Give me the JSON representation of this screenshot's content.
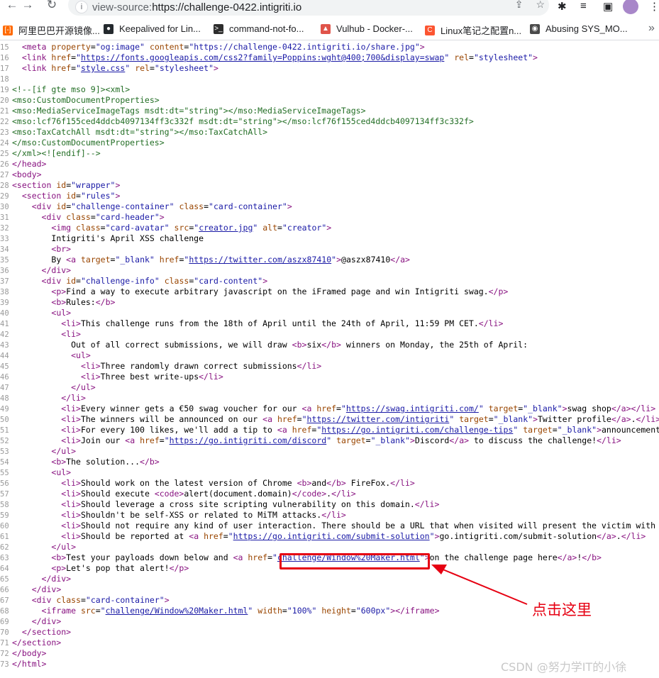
{
  "browser": {
    "url_scheme": "view-source:",
    "url_rest": "https://challenge-0422.intigriti.io"
  },
  "bookmarks": [
    {
      "label": "阿里巴巴开源镜像...",
      "icon": "aliyun-icon",
      "color": "#ff6a00"
    },
    {
      "label": "Keepalived for Lin...",
      "icon": "github-icon",
      "color": "#24292e"
    },
    {
      "label": "command-not-fo...",
      "icon": "terminal-icon",
      "color": "#2d2d2d"
    },
    {
      "label": "Vulhub - Docker-...",
      "icon": "vulhub-icon",
      "color": "#e0544a"
    },
    {
      "label": "Linux笔记之配置n...",
      "icon": "csdn-icon",
      "color": "#fc5531"
    },
    {
      "label": "Abusing SYS_MO...",
      "icon": "globe-icon",
      "color": "#4a4a4a"
    }
  ],
  "source_lines": [
    {
      "n": "15",
      "html": "  <span class='tag'>&lt;meta</span> <span class='attr'>property</span>=<span class='val'>\"og:image\"</span> <span class='attr'>content</span>=<span class='val'>\"https://challenge-0422.intigriti.io/share.jpg\"</span><span class='tag'>&gt;</span>"
    },
    {
      "n": "16",
      "html": "  <span class='tag'>&lt;link</span> <span class='attr'>href</span>=<span class='val'>\"</span><span class='link'>https://fonts.googleapis.com/css2?family=Poppins:wght@400;700&amp;display=swap</span><span class='val'>\"</span> <span class='attr'>rel</span>=<span class='val'>\"stylesheet\"</span><span class='tag'>&gt;</span>"
    },
    {
      "n": "17",
      "html": "  <span class='tag'>&lt;link</span> <span class='attr'>href</span>=<span class='val'>\"</span><span class='link'>style.css</span><span class='val'>\"</span> <span class='attr'>rel</span>=<span class='val'>\"stylesheet\"</span><span class='tag'>&gt;</span>"
    },
    {
      "n": "18",
      "html": ""
    },
    {
      "n": "19",
      "html": "<span class='comment'>&lt;!--[if gte mso 9]&gt;&lt;xml&gt;</span>"
    },
    {
      "n": "20",
      "html": "<span class='comment'>&lt;mso:CustomDocumentProperties&gt;</span>"
    },
    {
      "n": "21",
      "html": "<span class='comment'>&lt;mso:MediaServiceImageTags msdt:dt=\"string\"&gt;&lt;/mso:MediaServiceImageTags&gt;</span>"
    },
    {
      "n": "22",
      "html": "<span class='comment'>&lt;mso:lcf76f155ced4ddcb4097134ff3c332f msdt:dt=\"string\"&gt;&lt;/mso:lcf76f155ced4ddcb4097134ff3c332f&gt;</span>"
    },
    {
      "n": "23",
      "html": "<span class='comment'>&lt;mso:TaxCatchAll msdt:dt=\"string\"&gt;&lt;/mso:TaxCatchAll&gt;</span>"
    },
    {
      "n": "24",
      "html": "<span class='comment'>&lt;/mso:CustomDocumentProperties&gt;</span>"
    },
    {
      "n": "25",
      "html": "<span class='comment'>&lt;/xml&gt;&lt;![endif]--&gt;</span>"
    },
    {
      "n": "26",
      "html": "<span class='tag'>&lt;/head&gt;</span>"
    },
    {
      "n": "27",
      "html": "<span class='tag'>&lt;body&gt;</span>"
    },
    {
      "n": "28",
      "html": "<span class='tag'>&lt;section</span> <span class='attr'>id</span>=<span class='val'>\"wrapper\"</span><span class='tag'>&gt;</span>"
    },
    {
      "n": "29",
      "html": "  <span class='tag'>&lt;section</span> <span class='attr'>id</span>=<span class='val'>\"rules\"</span><span class='tag'>&gt;</span>"
    },
    {
      "n": "30",
      "html": "    <span class='tag'>&lt;div</span> <span class='attr'>id</span>=<span class='val'>\"challenge-container\"</span> <span class='attr'>class</span>=<span class='val'>\"card-container\"</span><span class='tag'>&gt;</span>"
    },
    {
      "n": "31",
      "html": "      <span class='tag'>&lt;div</span> <span class='attr'>class</span>=<span class='val'>\"card-header\"</span><span class='tag'>&gt;</span>"
    },
    {
      "n": "32",
      "html": "        <span class='tag'>&lt;img</span> <span class='attr'>class</span>=<span class='val'>\"card-avatar\"</span> <span class='attr'>src</span>=<span class='val'>\"</span><span class='link'>creator.jpg</span><span class='val'>\"</span> <span class='attr'>alt</span>=<span class='val'>\"creator\"</span><span class='tag'>&gt;</span>"
    },
    {
      "n": "33",
      "html": "        <span class='txt'>Intigriti's April XSS challenge</span>"
    },
    {
      "n": "34",
      "html": "        <span class='tag'>&lt;br&gt;</span>"
    },
    {
      "n": "35",
      "html": "        <span class='txt'>By </span><span class='tag'>&lt;a</span> <span class='attr'>target</span>=<span class='val'>\"_blank\"</span> <span class='attr'>href</span>=<span class='val'>\"</span><span class='link'>https://twitter.com/aszx87410</span><span class='val'>\"</span><span class='tag'>&gt;</span><span class='txt'>@aszx87410</span><span class='tag'>&lt;/a&gt;</span>"
    },
    {
      "n": "36",
      "html": "      <span class='tag'>&lt;/div&gt;</span>"
    },
    {
      "n": "37",
      "html": "      <span class='tag'>&lt;div</span> <span class='attr'>id</span>=<span class='val'>\"challenge-info\"</span> <span class='attr'>class</span>=<span class='val'>\"card-content\"</span><span class='tag'>&gt;</span>"
    },
    {
      "n": "38",
      "html": "        <span class='tag'>&lt;p&gt;</span><span class='txt'>Find a way to execute arbitrary javascript on the iFramed page and win Intigriti swag.</span><span class='tag'>&lt;/p&gt;</span>"
    },
    {
      "n": "39",
      "html": "        <span class='tag'>&lt;b&gt;</span><span class='txt'>Rules:</span><span class='tag'>&lt;/b&gt;</span>"
    },
    {
      "n": "40",
      "html": "        <span class='tag'>&lt;ul&gt;</span>"
    },
    {
      "n": "41",
      "html": "          <span class='tag'>&lt;li&gt;</span><span class='txt'>This challenge runs from the 18th of April until the 24th of April, 11:59 PM CET.</span><span class='tag'>&lt;/li&gt;</span>"
    },
    {
      "n": "42",
      "html": "          <span class='tag'>&lt;li&gt;</span>"
    },
    {
      "n": "43",
      "html": "            <span class='txt'>Out of all correct submissions, we will draw </span><span class='tag'>&lt;b&gt;</span><span class='txt'>six</span><span class='tag'>&lt;/b&gt;</span><span class='txt'> winners on Monday, the 25th of April:</span>"
    },
    {
      "n": "44",
      "html": "            <span class='tag'>&lt;ul&gt;</span>"
    },
    {
      "n": "45",
      "html": "              <span class='tag'>&lt;li&gt;</span><span class='txt'>Three randomly drawn correct submissions</span><span class='tag'>&lt;/li&gt;</span>"
    },
    {
      "n": "46",
      "html": "              <span class='tag'>&lt;li&gt;</span><span class='txt'>Three best write-ups</span><span class='tag'>&lt;/li&gt;</span>"
    },
    {
      "n": "47",
      "html": "            <span class='tag'>&lt;/ul&gt;</span>"
    },
    {
      "n": "48",
      "html": "          <span class='tag'>&lt;/li&gt;</span>"
    },
    {
      "n": "49",
      "html": "          <span class='tag'>&lt;li&gt;</span><span class='txt'>Every winner gets a €50 swag voucher for our </span><span class='tag'>&lt;a</span> <span class='attr'>href</span>=<span class='val'>\"</span><span class='link'>https://swag.intigriti.com/</span><span class='val'>\"</span> <span class='attr'>target</span>=<span class='val'>\"_blank\"</span><span class='tag'>&gt;</span><span class='txt'>swag shop</span><span class='tag'>&lt;/a&gt;&lt;/li&gt;</span>"
    },
    {
      "n": "50",
      "html": "          <span class='tag'>&lt;li&gt;</span><span class='txt'>The winners will be announced on our </span><span class='tag'>&lt;a</span> <span class='attr'>href</span>=<span class='val'>\"</span><span class='link'>https://twitter.com/intigriti</span><span class='val'>\"</span> <span class='attr'>target</span>=<span class='val'>\"_blank\"</span><span class='tag'>&gt;</span><span class='txt'>Twitter profile</span><span class='tag'>&lt;/a&gt;</span><span class='txt'>.</span><span class='tag'>&lt;/li&gt;</span>"
    },
    {
      "n": "51",
      "html": "          <span class='tag'>&lt;li&gt;</span><span class='txt'>For every 100 likes, we'll add a tip to </span><span class='tag'>&lt;a</span> <span class='attr'>href</span>=<span class='val'>\"</span><span class='link'>https://go.intigriti.com/challenge-tips</span><span class='val'>\"</span> <span class='attr'>target</span>=<span class='val'>\"_blank\"</span><span class='tag'>&gt;</span><span class='txt'>announcements</span><span class='tag'>&lt;/a&gt;</span>"
    },
    {
      "n": "52",
      "html": "          <span class='tag'>&lt;li&gt;</span><span class='txt'>Join our </span><span class='tag'>&lt;a</span> <span class='attr'>href</span>=<span class='val'>\"</span><span class='link'>https://go.intigriti.com/discord</span><span class='val'>\"</span> <span class='attr'>target</span>=<span class='val'>\"_blank\"</span><span class='tag'>&gt;</span><span class='txt'>Discord</span><span class='tag'>&lt;/a&gt;</span><span class='txt'> to discuss the challenge!</span><span class='tag'>&lt;/li&gt;</span>"
    },
    {
      "n": "53",
      "html": "        <span class='tag'>&lt;/ul&gt;</span>"
    },
    {
      "n": "54",
      "html": "        <span class='tag'>&lt;b&gt;</span><span class='txt'>The solution...</span><span class='tag'>&lt;/b&gt;</span>"
    },
    {
      "n": "55",
      "html": "        <span class='tag'>&lt;ul&gt;</span>"
    },
    {
      "n": "56",
      "html": "          <span class='tag'>&lt;li&gt;</span><span class='txt'>Should work on the latest version of Chrome </span><span class='tag'>&lt;b&gt;</span><span class='txt'>and</span><span class='tag'>&lt;/b&gt;</span><span class='txt'> FireFox.</span><span class='tag'>&lt;/li&gt;</span>"
    },
    {
      "n": "57",
      "html": "          <span class='tag'>&lt;li&gt;</span><span class='txt'>Should execute </span><span class='tag'>&lt;code&gt;</span><span class='txt'>alert(document.domain)</span><span class='tag'>&lt;/code&gt;</span><span class='txt'>.</span><span class='tag'>&lt;/li&gt;</span>"
    },
    {
      "n": "58",
      "html": "          <span class='tag'>&lt;li&gt;</span><span class='txt'>Should leverage a cross site scripting vulnerability on this domain.</span><span class='tag'>&lt;/li&gt;</span>"
    },
    {
      "n": "59",
      "html": "          <span class='tag'>&lt;li&gt;</span><span class='txt'>Shouldn't be self-XSS or related to MiTM attacks.</span><span class='tag'>&lt;/li&gt;</span>"
    },
    {
      "n": "60",
      "html": "          <span class='tag'>&lt;li&gt;</span><span class='txt'>Should not require any kind of user interaction. There should be a URL that when visited will present the victim with</span>"
    },
    {
      "n": "61",
      "html": "          <span class='tag'>&lt;li&gt;</span><span class='txt'>Should be reported at </span><span class='tag'>&lt;a</span> <span class='attr'>href</span>=<span class='val'>\"</span><span class='link'>https://go.intigriti.com/submit-solution</span><span class='val'>\"</span><span class='tag'>&gt;</span><span class='txt'>go.intigriti.com/submit-solution</span><span class='tag'>&lt;/a&gt;</span><span class='txt'>.</span><span class='tag'>&lt;/li&gt;</span>"
    },
    {
      "n": "62",
      "html": "        <span class='tag'>&lt;/ul&gt;</span>"
    },
    {
      "n": "63",
      "html": "        <span class='tag'>&lt;b&gt;</span><span class='txt'>Test your payloads down below and </span><span class='tag'>&lt;a</span> <span class='attr'>href</span>=<span class='val'>\"</span><span class='link'>challenge/Window%20Maker.html</span><span class='val'>\"</span><span class='tag'>&gt;</span><span class='txt'>on the challenge page here</span><span class='tag'>&lt;/a&gt;</span><span class='txt'>!</span><span class='tag'>&lt;/b&gt;</span>"
    },
    {
      "n": "64",
      "html": "        <span class='tag'>&lt;p&gt;</span><span class='txt'>Let's pop that alert!</span><span class='tag'>&lt;/p&gt;</span>"
    },
    {
      "n": "65",
      "html": "      <span class='tag'>&lt;/div&gt;</span>"
    },
    {
      "n": "66",
      "html": "    <span class='tag'>&lt;/div&gt;</span>"
    },
    {
      "n": "67",
      "html": "    <span class='tag'>&lt;div</span> <span class='attr'>class</span>=<span class='val'>\"card-container\"</span><span class='tag'>&gt;</span>"
    },
    {
      "n": "68",
      "html": "      <span class='tag'>&lt;iframe</span> <span class='attr'>src</span>=<span class='val'>\"</span><span class='link'>challenge/Window%20Maker.html</span><span class='val'>\"</span> <span class='attr'>width</span>=<span class='val'>\"100%\"</span> <span class='attr'>height</span>=<span class='val'>\"600px\"</span><span class='tag'>&gt;&lt;/iframe&gt;</span>"
    },
    {
      "n": "69",
      "html": "    <span class='tag'>&lt;/div&gt;</span>"
    },
    {
      "n": "70",
      "html": "  <span class='tag'>&lt;/section&gt;</span>"
    },
    {
      "n": "71",
      "html": "<span class='tag'>&lt;/section&gt;</span>"
    },
    {
      "n": "72",
      "html": "<span class='tag'>&lt;/body&gt;</span>"
    },
    {
      "n": "73",
      "html": "<span class='tag'>&lt;/html&gt;</span>"
    }
  ],
  "annotation": {
    "text": "点击这里",
    "color": "#e60012"
  },
  "watermark": "CSDN @努力学IT的小徐"
}
